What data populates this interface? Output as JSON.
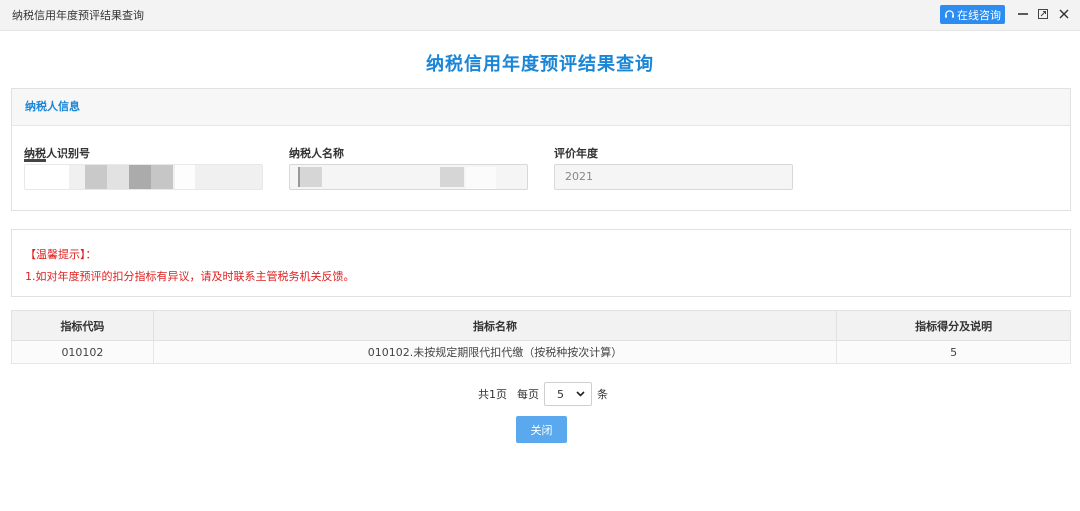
{
  "window": {
    "title": "纳税信用年度预评结果查询",
    "consult_label": "在线咨询",
    "consult_icon": "headset-icon",
    "accent_color": "#2d8cf0"
  },
  "page": {
    "title": "纳税信用年度预评结果查询",
    "title_color": "#1a86d8"
  },
  "taxpayer_info": {
    "section_title": "纳税人信息",
    "id_label": "纳税人识别号",
    "id_value": "",
    "name_label": "纳税人名称",
    "name_value": "",
    "year_label": "评价年度",
    "year_value": "2021"
  },
  "tips": {
    "title": "【温馨提示】：",
    "lines": [
      "1.如对年度预评的扣分指标有异议，请及时联系主管税务机关反馈。"
    ],
    "color": "#e02020"
  },
  "table": {
    "headers": [
      "指标代码",
      "指标名称",
      "指标得分及说明"
    ],
    "rows": [
      [
        "010102",
        "010102.未按规定期限代扣代缴（按税种按次计算）",
        "5"
      ]
    ]
  },
  "pagination": {
    "total_pages": "共1页",
    "per_page_prefix": "每页",
    "per_page_value": "5",
    "per_page_suffix": "条"
  },
  "actions": {
    "close_label": "关闭"
  }
}
